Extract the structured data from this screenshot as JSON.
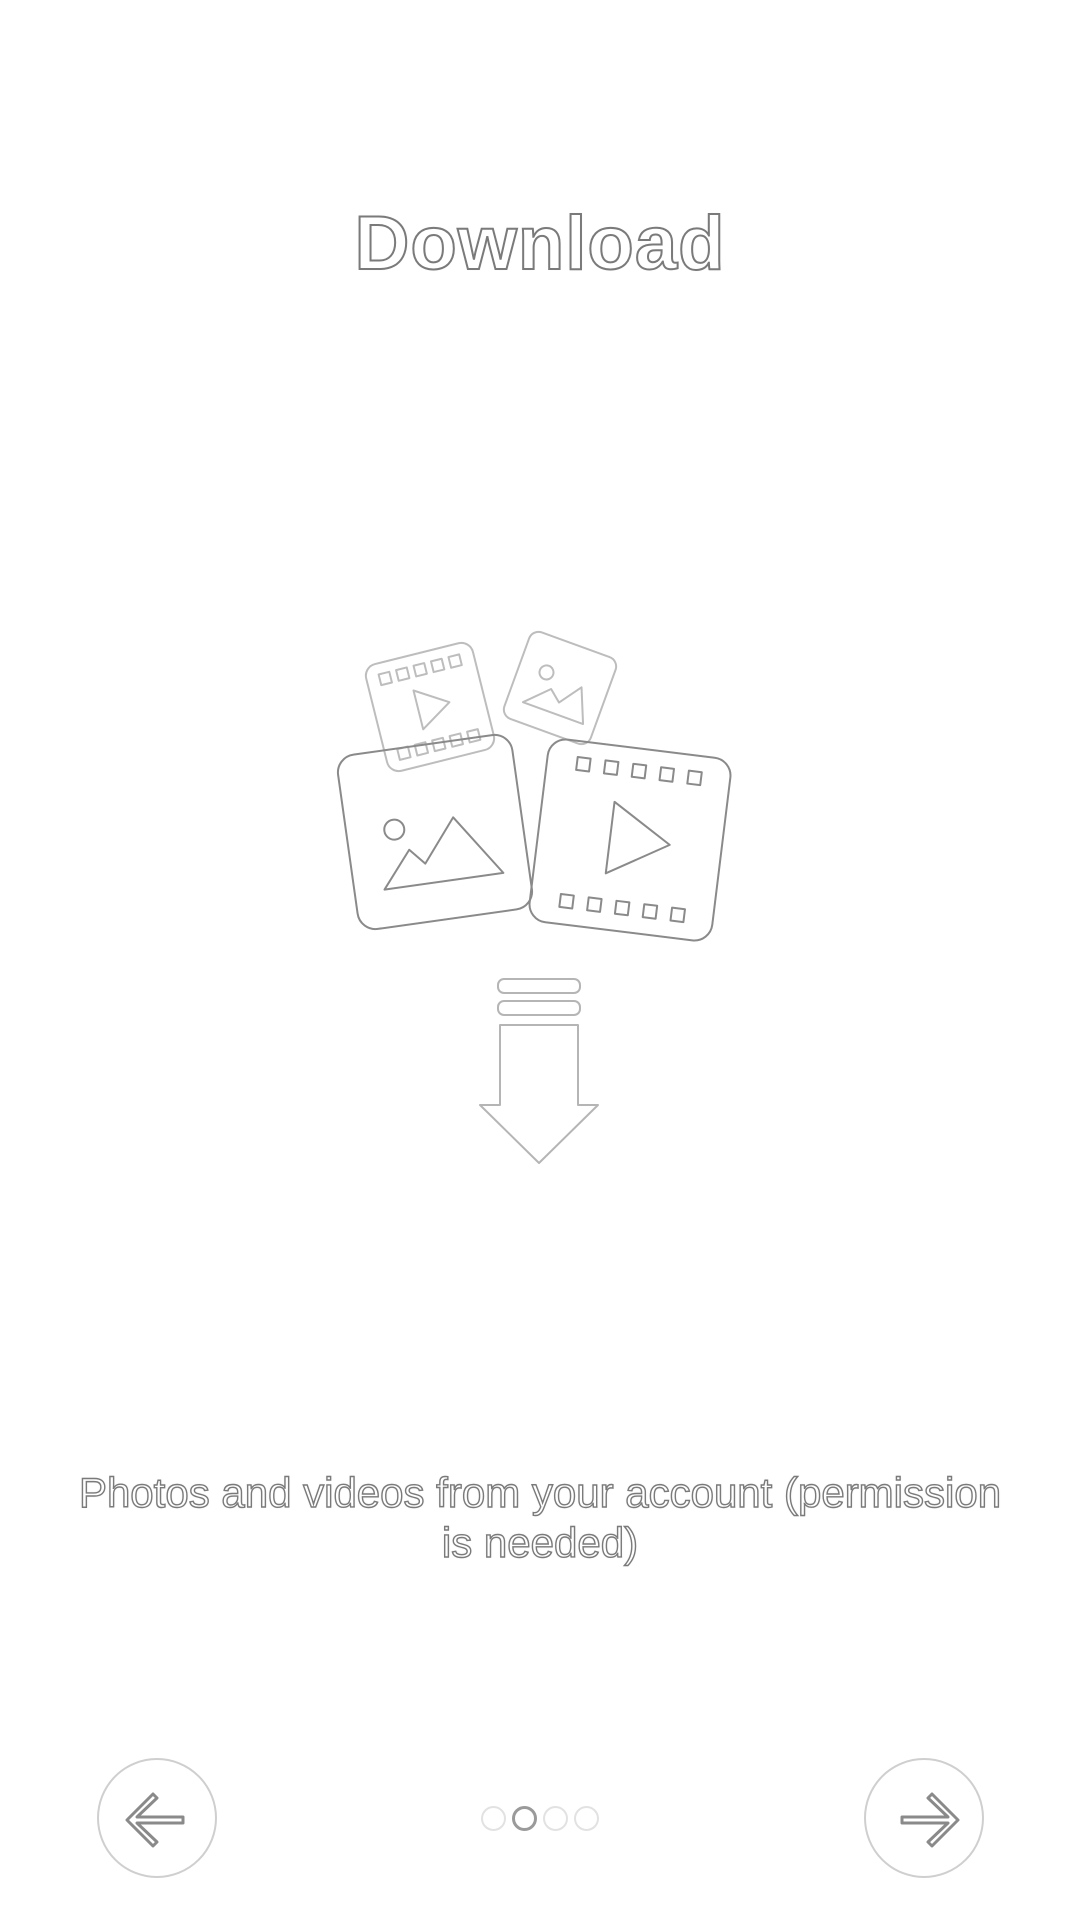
{
  "onboarding": {
    "title": "Download",
    "description": "Photos and videos from your account (permission is needed)",
    "page_indicator": {
      "total": 4,
      "active_index": 1
    },
    "prev_icon": "arrow-left-icon",
    "next_icon": "arrow-right-icon",
    "illustration_icons": [
      "video-icon",
      "photo-icon",
      "photo-icon",
      "video-icon",
      "download-arrow-icon"
    ]
  },
  "colors": {
    "background": "#ffffff",
    "outline": "#7a7a7a",
    "light_outline": "#cfcfcf"
  }
}
